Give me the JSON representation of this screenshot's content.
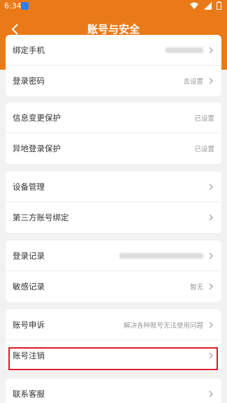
{
  "status": {
    "time": "6:34"
  },
  "nav": {
    "title": "账号与安全"
  },
  "groups": [
    {
      "rows": [
        {
          "label": "绑定手机",
          "value": "",
          "hidden_value": true
        },
        {
          "label": "登录密码",
          "value": "去设置"
        }
      ]
    },
    {
      "rows": [
        {
          "label": "信息变更保护",
          "value": "已设置"
        },
        {
          "label": "异地登录保护",
          "value": "已设置"
        }
      ]
    },
    {
      "rows": [
        {
          "label": "设备管理",
          "value": ""
        },
        {
          "label": "第三方账号绑定",
          "value": ""
        }
      ]
    },
    {
      "rows": [
        {
          "label": "登录记录",
          "value": "",
          "hidden_value": true
        },
        {
          "label": "敏感记录",
          "value": "暂无"
        }
      ]
    },
    {
      "rows": [
        {
          "label": "账号申诉",
          "value": "解决各种账号无法使用问题"
        },
        {
          "label": "账号注销",
          "value": ""
        }
      ]
    },
    {
      "rows": [
        {
          "label": "联系客服",
          "value": ""
        }
      ]
    }
  ]
}
